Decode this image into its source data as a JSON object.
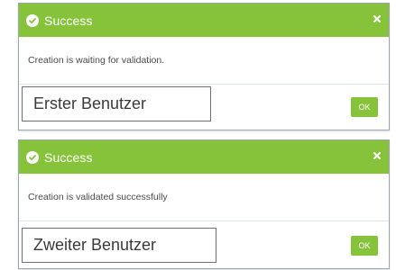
{
  "dialogs": [
    {
      "title": "Success",
      "message": "Creation is waiting for validation.",
      "ok_label": "OK",
      "annotation": "Erster Benutzer"
    },
    {
      "title": "Success",
      "message": "Creation is validated successfully",
      "ok_label": "OK",
      "annotation": "Zweiter Benutzer"
    }
  ],
  "icons": {
    "header": "check-circle-icon",
    "close": "close-icon"
  },
  "colors": {
    "header_green": "#86c33a",
    "button_green": "#86c33a",
    "border": "#9aa7b2"
  }
}
